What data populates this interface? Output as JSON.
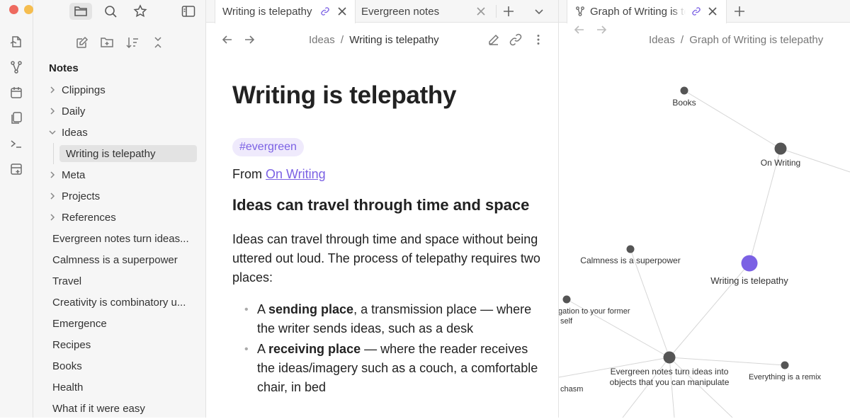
{
  "app": {
    "window_controls": [
      "close",
      "minimize",
      "zoom"
    ],
    "colors": {
      "accent": "#7b61e4",
      "close": "#ee6a5f",
      "minimize": "#f5bd4f",
      "zoom": "#61c554"
    }
  },
  "ribbon": {
    "icons": [
      "open-quick-switcher-icon",
      "graph-view-icon",
      "daily-note-icon",
      "templates-icon",
      "command-palette-icon",
      "new-canvas-icon"
    ]
  },
  "sidebar": {
    "top_icons": [
      "files-icon",
      "search-icon",
      "bookmarks-icon"
    ],
    "toggle_icon": "sidebar-toggle-icon",
    "nav_actions": [
      "new-note-icon",
      "new-folder-icon",
      "sort-icon",
      "collapse-all-icon"
    ],
    "vault_title": "Notes",
    "folders": [
      "Clippings",
      "Daily",
      "Ideas",
      "Meta",
      "Projects",
      "References"
    ],
    "active_child": "Writing is telepathy",
    "files": [
      "Evergreen notes turn ideas...",
      "Calmness is a superpower",
      "Travel",
      "Creativity is combinatory u...",
      "Emergence",
      "Recipes",
      "Books",
      "Health",
      "What if it were easy"
    ]
  },
  "tabs": {
    "left": [
      {
        "label": "Writing is telepathy",
        "active": true
      },
      {
        "label": "Evergreen notes",
        "active": false
      }
    ],
    "right": [
      {
        "label": "Graph of Writing is telepathy",
        "active": true
      }
    ],
    "new_tab_icon": "plus-icon",
    "tab_list_icon": "chevron-down-icon"
  },
  "editor": {
    "breadcrumb": {
      "parent": "Ideas",
      "sep": "/",
      "current": "Writing is telepathy"
    },
    "title": "Writing is telepathy",
    "tag": "#evergreen",
    "from_prefix": "From ",
    "from_link": "On Writing",
    "heading": "Ideas can travel through time and space",
    "paragraph": "Ideas can travel through time and space without being uttered out loud. The process of telepathy requires two places:",
    "bullets": [
      {
        "prefix": "A ",
        "bold": "sending place",
        "rest": ", a transmission place — where the writer sends ideas, such as a desk"
      },
      {
        "prefix": "A ",
        "bold": "receiving place",
        "rest": " — where the reader receives the ideas/imagery such as a couch, a comfortable chair, in bed"
      }
    ]
  },
  "graph": {
    "breadcrumb": {
      "parent": "Ideas",
      "sep": "/",
      "current": "Graph of Writing is telepathy"
    },
    "nodes": [
      {
        "label": "Books"
      },
      {
        "label": "On Writing"
      },
      {
        "label": "Calmness is a superpower"
      },
      {
        "label": "Writing is telepathy",
        "active": true
      },
      {
        "label": "gation to your former"
      },
      {
        "label": "self"
      },
      {
        "label": "Evergreen notes turn ideas into"
      },
      {
        "label": "objects that you can manipulate"
      },
      {
        "label": "Everything is a remix"
      },
      {
        "label": "chasm"
      }
    ]
  }
}
